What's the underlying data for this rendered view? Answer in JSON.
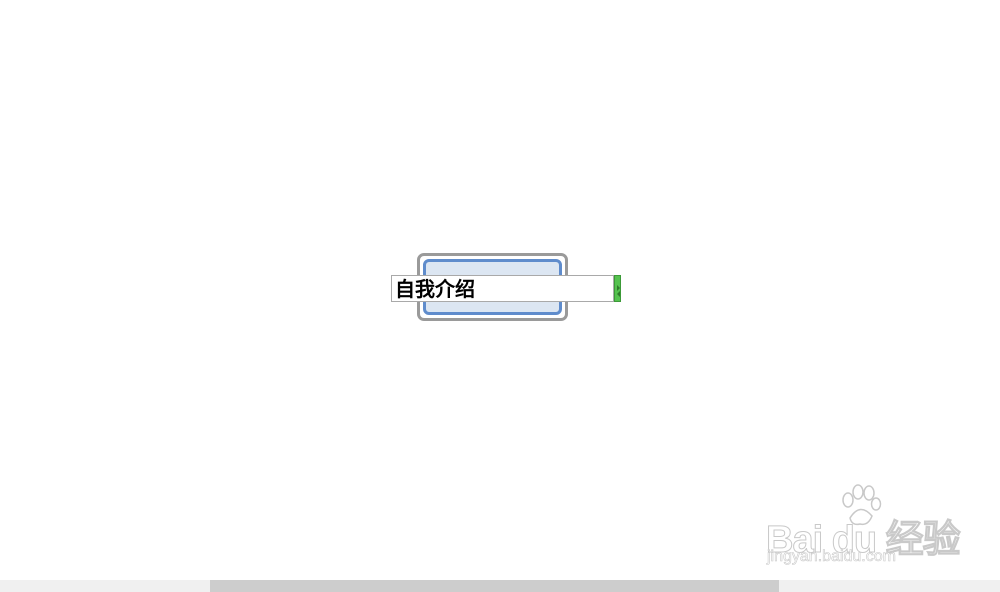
{
  "mindmap": {
    "central_topic": {
      "editing_text": "自我介绍",
      "fill_color": "#dce6f2",
      "border_color": "#5f8ccc",
      "selection_color": "#9a9a9a"
    },
    "editor": {
      "handle_icon": "resize-handle-icon",
      "handle_color": "#55c24f"
    }
  },
  "watermark": {
    "brand": "Bai du 经验",
    "url": "jingyan.baidu.com"
  },
  "scrollbar": {
    "position": 0.21
  }
}
